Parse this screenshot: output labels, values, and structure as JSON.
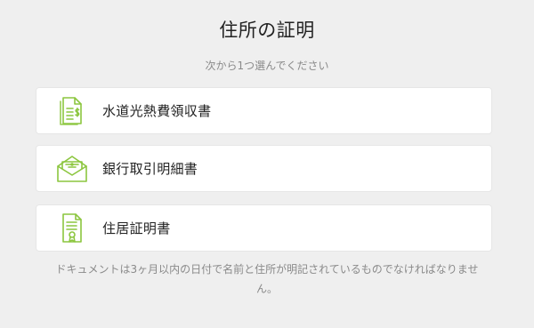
{
  "page": {
    "title": "住所の証明",
    "subtitle": "次から1つ選んでください",
    "footnote": "ドキュメントは3ヶ月以内の日付で名前と住所が明記されているものでなければなりません。"
  },
  "options": [
    {
      "label": "水道光熱費領収書",
      "icon": "utility-bill-icon"
    },
    {
      "label": "銀行取引明細書",
      "icon": "bank-statement-envelope-icon"
    },
    {
      "label": "住居証明書",
      "icon": "certificate-icon"
    }
  ],
  "colors": {
    "background": "#efefef",
    "card": "#ffffff",
    "icon_green": "#8cc63f",
    "muted_text": "#8a8a8a"
  }
}
